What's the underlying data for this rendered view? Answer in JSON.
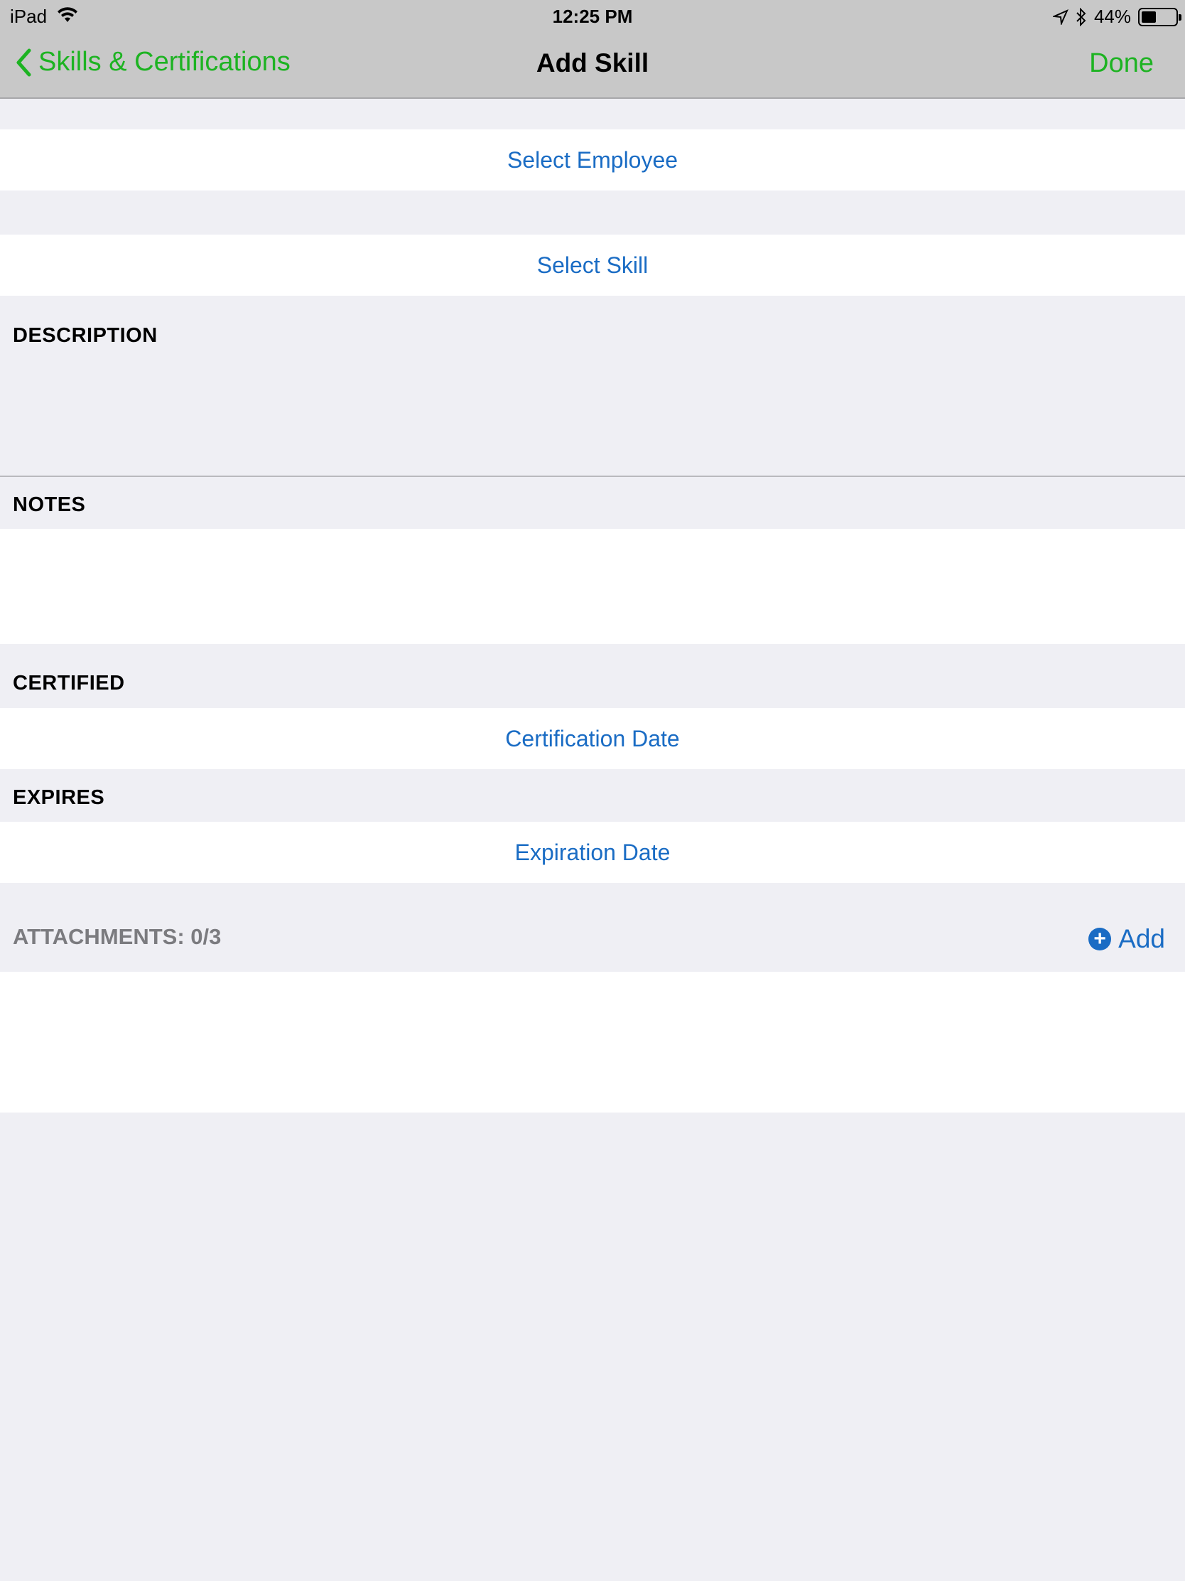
{
  "status_bar": {
    "device": "iPad",
    "time": "12:25 PM",
    "battery": "44%",
    "battery_level": 0.44
  },
  "nav": {
    "back_label": "Skills & Certifications",
    "title": "Add Skill",
    "done_label": "Done"
  },
  "form": {
    "select_employee": "Select Employee",
    "select_skill": "Select Skill",
    "description_label": "DESCRIPTION",
    "notes_label": "NOTES",
    "certified_label": "CERTIFIED",
    "certification_date": "Certification Date",
    "expires_label": "EXPIRES",
    "expiration_date": "Expiration Date"
  },
  "attachments": {
    "label": "ATTACHMENTS: 0/3",
    "add_label": "Add"
  },
  "colors": {
    "accent_green": "#1db322",
    "link_blue": "#1a6cc4",
    "background": "#efeff4"
  }
}
